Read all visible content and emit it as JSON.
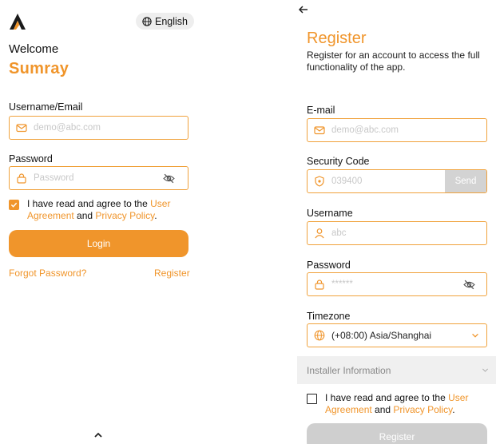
{
  "login": {
    "language": "English",
    "welcome": "Welcome",
    "brand": "Sumray",
    "username_label": "Username/Email",
    "username_placeholder": "demo@abc.com",
    "password_label": "Password",
    "password_placeholder": "Password",
    "agree_prefix": "I have read and agree to the ",
    "agree_user_agreement": "User Agreement",
    "agree_and": " and ",
    "agree_privacy": "Privacy Policy",
    "agree_suffix": ".",
    "agree_checked": true,
    "login_button": "Login",
    "forgot_password": "Forgot Password?",
    "register_link": "Register"
  },
  "register": {
    "title": "Register",
    "subtitle": "Register for an account to access the full functionality of the app.",
    "email_label": "E-mail",
    "email_placeholder": "demo@abc.com",
    "security_code_label": "Security Code",
    "security_code_placeholder": "039400",
    "send_button": "Send",
    "username_label": "Username",
    "username_placeholder": "abc",
    "password_label": "Password",
    "password_placeholder": "******",
    "timezone_label": "Timezone",
    "timezone_value": "(+08:00) Asia/Shanghai",
    "installer_section": "Installer Information",
    "agree_prefix": "I have read and agree to the ",
    "agree_user_agreement": "User Agreement",
    "agree_and": " and ",
    "agree_privacy": "Privacy Policy",
    "agree_suffix": ".",
    "agree_checked": false,
    "register_button": "Register"
  },
  "colors": {
    "accent": "#f0952b",
    "input_border": "#f0a23c",
    "disabled": "#cfcfcf",
    "section_bg": "#f0f0f0"
  },
  "icons": [
    "logo-icon",
    "globe-icon",
    "mail-icon",
    "lock-icon",
    "eye-off-icon",
    "check-icon",
    "chevron-up-icon",
    "back-arrow-icon",
    "shield-icon",
    "user-icon",
    "timezone-icon",
    "chevron-down-icon"
  ]
}
